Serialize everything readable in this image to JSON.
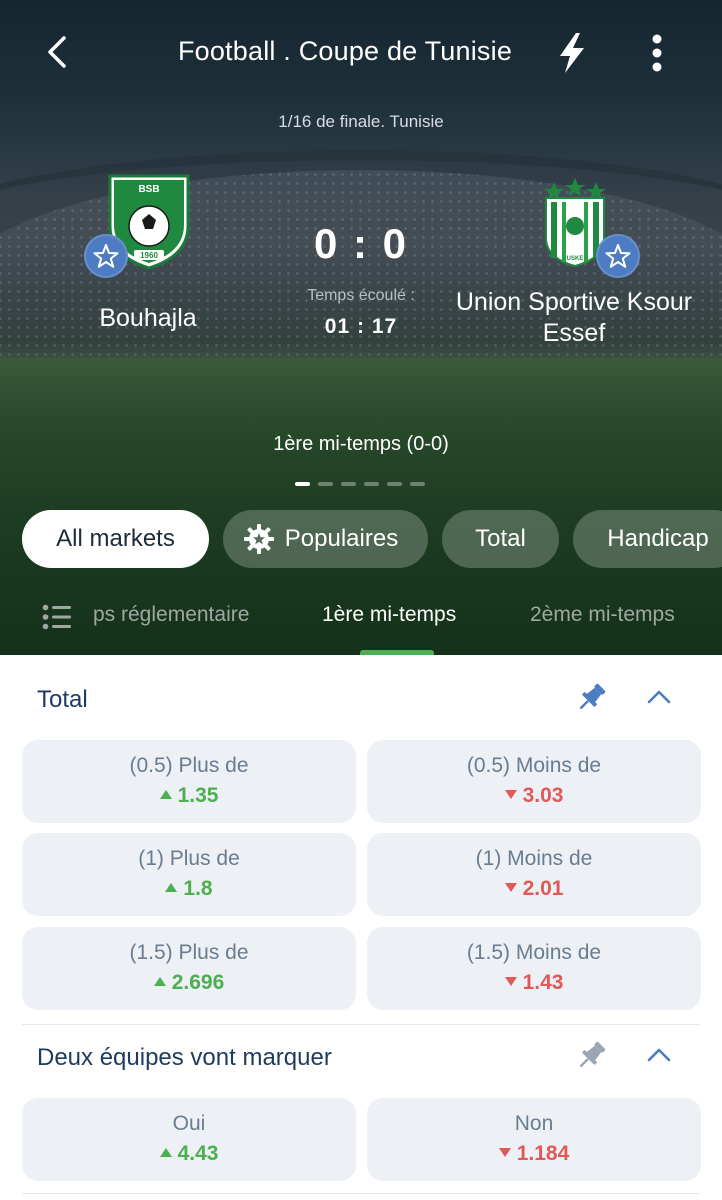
{
  "header": {
    "title": "Football . Coupe de Tunisie",
    "subtitle": "1/16 de finale. Tunisie"
  },
  "match": {
    "home": {
      "name": "Bouhajla",
      "logo_text": "BSB",
      "logo_year": "1960"
    },
    "away": {
      "name_line1": "Union Sportive Ksour",
      "name_line2": "Essef",
      "logo_text": "USKE"
    },
    "score": "0 : 0",
    "elapsed_label": "Temps écoulé :",
    "elapsed_time": "01 : 17",
    "period": "1ère mi-temps (0-0)"
  },
  "filters": [
    {
      "label": "All markets",
      "active": true
    },
    {
      "label": "Populaires",
      "icon": "gear-icon",
      "active": false
    },
    {
      "label": "Total",
      "active": false
    },
    {
      "label": "Handicap",
      "active": false
    }
  ],
  "tabs": [
    {
      "label": "ps réglementaire",
      "active": false
    },
    {
      "label": "1ère mi-temps",
      "active": true
    },
    {
      "label": "2ème mi-temps",
      "active": false
    }
  ],
  "markets": [
    {
      "title": "Total",
      "pinned": true,
      "odds": [
        {
          "label": "(0.5) Plus de",
          "value": "1.35",
          "trend": "up"
        },
        {
          "label": "(0.5) Moins de",
          "value": "3.03",
          "trend": "down"
        },
        {
          "label": "(1) Plus de",
          "value": "1.8",
          "trend": "up"
        },
        {
          "label": "(1) Moins de",
          "value": "2.01",
          "trend": "down"
        },
        {
          "label": "(1.5) Plus de",
          "value": "2.696",
          "trend": "up"
        },
        {
          "label": "(1.5) Moins de",
          "value": "1.43",
          "trend": "down"
        }
      ]
    },
    {
      "title": "Deux équipes vont marquer",
      "pinned": false,
      "odds": [
        {
          "label": "Oui",
          "value": "4.43",
          "trend": "up"
        },
        {
          "label": "Non",
          "value": "1.184",
          "trend": "down"
        }
      ]
    }
  ],
  "colors": {
    "accent_green": "#4caf50",
    "odd_up": "#4caf50",
    "odd_down": "#e05858",
    "section_title": "#1d3a5f",
    "star_badge": "#4d7cc3",
    "pin_active": "#4d7cc3",
    "pin_inactive": "#9aa6b4"
  }
}
